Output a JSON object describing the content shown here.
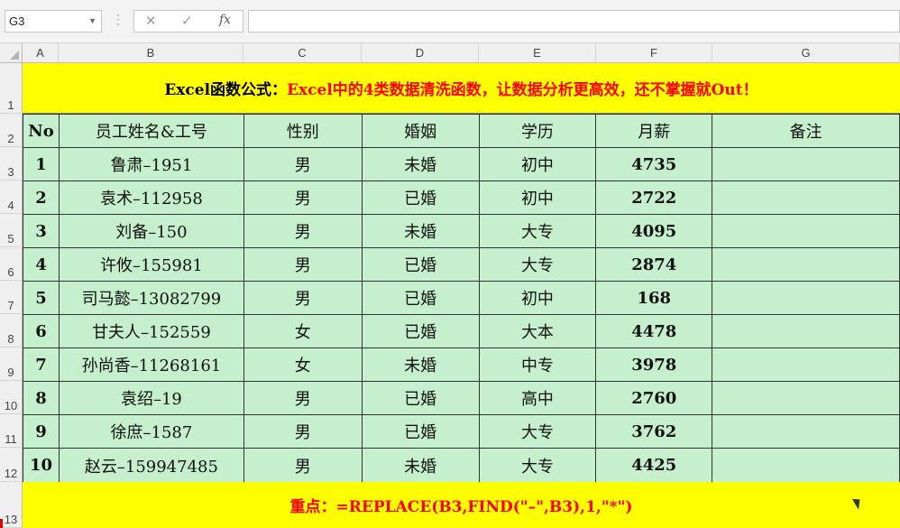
{
  "toolbar": {
    "name_box": "G3",
    "cancel_symbol": "✕",
    "enter_symbol": "✓",
    "fx_label": "fx",
    "formula_value": ""
  },
  "columns": [
    "A",
    "B",
    "C",
    "D",
    "E",
    "F",
    "G"
  ],
  "rows": [
    "1",
    "2",
    "3",
    "4",
    "5",
    "6",
    "7",
    "8",
    "9",
    "10",
    "11",
    "12",
    "13"
  ],
  "title": {
    "part1": "Excel函数公式：",
    "part2": "Excel中的4类数据清洗函数，让数据分析更高效，还不掌握就Out！"
  },
  "table": {
    "headers": [
      "No",
      "员工姓名&工号",
      "性别",
      "婚姻",
      "学历",
      "月薪",
      "备注"
    ],
    "rows": [
      [
        "1",
        "鲁肃–1951",
        "男",
        "未婚",
        "初中",
        "4735",
        ""
      ],
      [
        "2",
        "袁术–112958",
        "男",
        "已婚",
        "初中",
        "2722",
        ""
      ],
      [
        "3",
        "刘备–150",
        "男",
        "未婚",
        "大专",
        "4095",
        ""
      ],
      [
        "4",
        "许攸–155981",
        "男",
        "已婚",
        "大专",
        "2874",
        ""
      ],
      [
        "5",
        "司马懿–13082799",
        "男",
        "已婚",
        "初中",
        "168",
        ""
      ],
      [
        "6",
        "甘夫人–152559",
        "女",
        "已婚",
        "大本",
        "4478",
        ""
      ],
      [
        "7",
        "孙尚香–11268161",
        "女",
        "未婚",
        "中专",
        "3978",
        ""
      ],
      [
        "8",
        "袁绍–19",
        "男",
        "已婚",
        "高中",
        "2760",
        ""
      ],
      [
        "9",
        "徐庶–1587",
        "男",
        "已婚",
        "大专",
        "3762",
        ""
      ],
      [
        "10",
        "赵云–159947485",
        "男",
        "未婚",
        "大专",
        "4425",
        ""
      ]
    ]
  },
  "bottom": {
    "text": "重点：=REPLACE(B3,FIND(\"–\",B3),1,\"*\")"
  },
  "colors": {
    "title_bg": "#ffff00",
    "table_bg": "#c6efce",
    "accent_red": "#ff0000"
  }
}
